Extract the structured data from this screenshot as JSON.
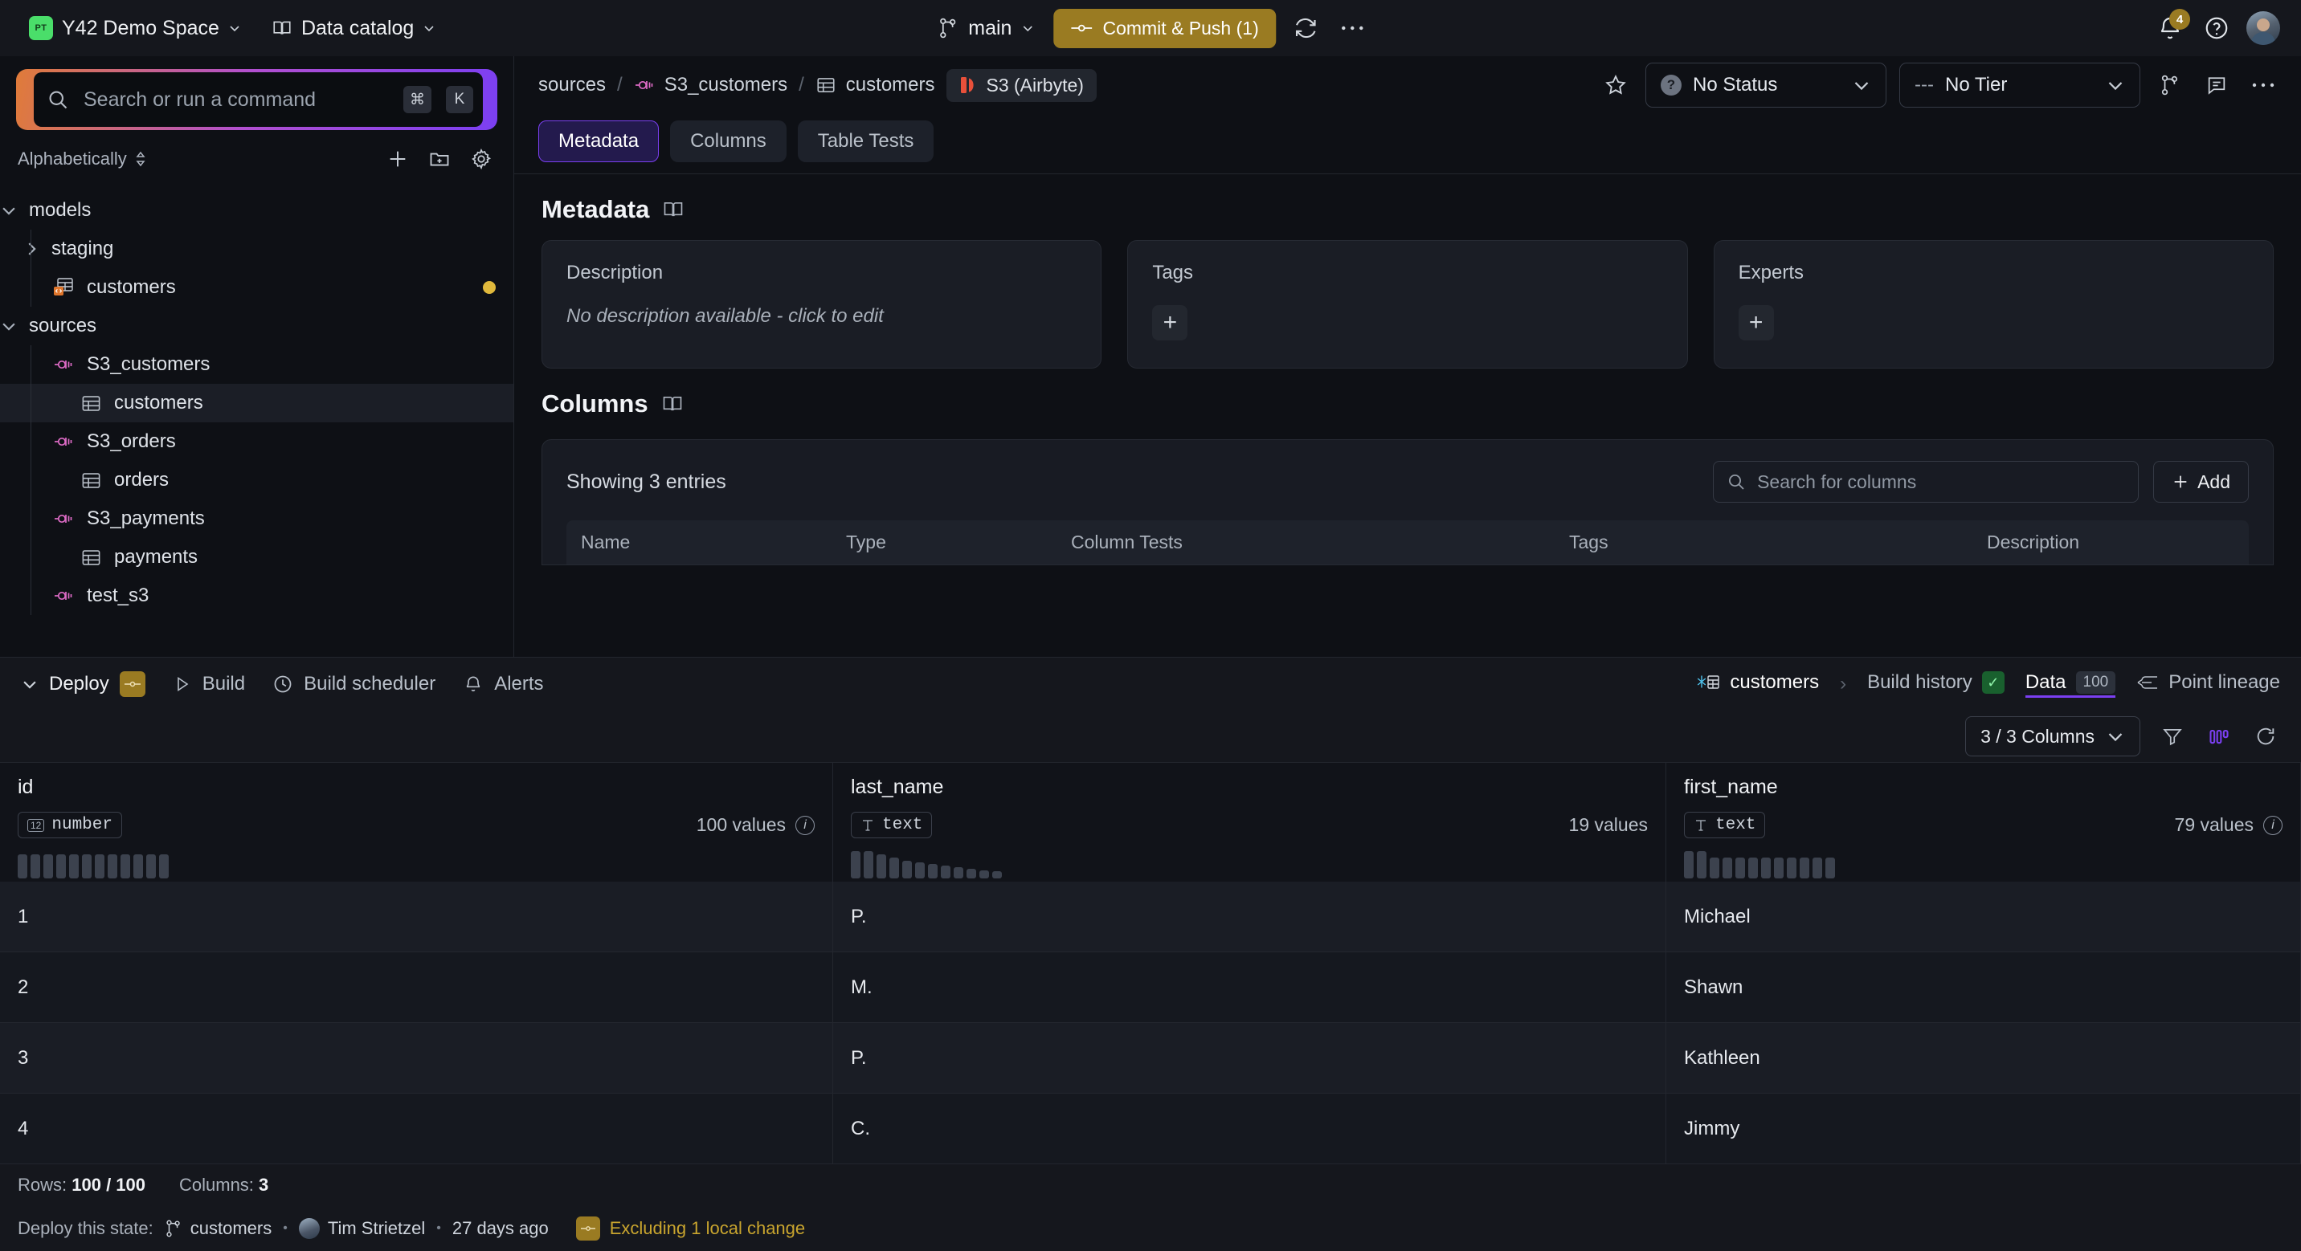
{
  "topbar": {
    "space_badge": "PT",
    "space_name": "Y42 Demo Space",
    "catalog_label": "Data catalog",
    "branch": "main",
    "commit_label": "Commit & Push (1)",
    "notification_count": "4"
  },
  "sidebar": {
    "search_placeholder": "Search or run a command",
    "kbd_cmd": "⌘",
    "kbd_key": "K",
    "sort_label": "Alphabetically",
    "tree": [
      {
        "label": "models",
        "indent": 0,
        "icon": "chevron-down",
        "kind": "folder",
        "selected": false,
        "dot": false
      },
      {
        "label": "staging",
        "indent": 1,
        "icon": "chevron-right",
        "kind": "folder",
        "selected": false,
        "dot": false
      },
      {
        "label": "customers",
        "indent": 1,
        "icon": "none",
        "kind": "model",
        "selected": false,
        "dot": true
      },
      {
        "label": "sources",
        "indent": 0,
        "icon": "chevron-down",
        "kind": "folder",
        "selected": false,
        "dot": false
      },
      {
        "label": "S3_customers",
        "indent": 1,
        "icon": "none",
        "kind": "source",
        "selected": false,
        "dot": false
      },
      {
        "label": "customers",
        "indent": 2,
        "icon": "none",
        "kind": "table",
        "selected": true,
        "dot": false
      },
      {
        "label": "S3_orders",
        "indent": 1,
        "icon": "none",
        "kind": "source",
        "selected": false,
        "dot": false
      },
      {
        "label": "orders",
        "indent": 2,
        "icon": "none",
        "kind": "table",
        "selected": false,
        "dot": false
      },
      {
        "label": "S3_payments",
        "indent": 1,
        "icon": "none",
        "kind": "source",
        "selected": false,
        "dot": false
      },
      {
        "label": "payments",
        "indent": 2,
        "icon": "none",
        "kind": "table",
        "selected": false,
        "dot": false
      },
      {
        "label": "test_s3",
        "indent": 1,
        "icon": "none",
        "kind": "source",
        "selected": false,
        "dot": false
      }
    ]
  },
  "breadcrumb": {
    "root": "sources",
    "source": "S3_customers",
    "table": "customers",
    "connector_chip": "S3 (Airbyte)",
    "status_label": "No Status",
    "tier_label": "No Tier",
    "tier_prefix": "---"
  },
  "tabs": [
    {
      "label": "Metadata",
      "active": true
    },
    {
      "label": "Columns",
      "active": false
    },
    {
      "label": "Table Tests",
      "active": false
    }
  ],
  "metadata": {
    "section_title": "Metadata",
    "description_title": "Description",
    "description_empty": "No description available - click to edit",
    "tags_title": "Tags",
    "experts_title": "Experts",
    "add_glyph": "+"
  },
  "columns_section": {
    "section_title": "Columns",
    "showing": "Showing 3 entries",
    "search_placeholder": "Search for columns",
    "add_label": "Add",
    "headers": [
      "Name",
      "Type",
      "Column Tests",
      "Tags",
      "Description"
    ]
  },
  "bottom_panel": {
    "deploy_label": "Deploy",
    "build_label": "Build",
    "build_scheduler_label": "Build scheduler",
    "alerts_label": "Alerts",
    "asset_name": "customers",
    "build_history_label": "Build history",
    "data_tab_label": "Data",
    "data_tab_count": "100",
    "point_lineage_label": "Point lineage",
    "columns_select_label": "3 / 3 Columns"
  },
  "grid": {
    "columns": [
      {
        "name": "id",
        "type": "number",
        "type_glyph": "12",
        "values_label": "100 values",
        "has_info": true,
        "histogram": [
          30,
          30,
          30,
          30,
          30,
          30,
          30,
          30,
          30,
          30,
          30,
          30
        ]
      },
      {
        "name": "last_name",
        "type": "text",
        "type_glyph": "T",
        "values_label": "19 values",
        "has_info": false,
        "histogram": [
          34,
          34,
          30,
          26,
          22,
          20,
          18,
          16,
          14,
          12,
          10,
          9
        ]
      },
      {
        "name": "first_name",
        "type": "text",
        "type_glyph": "T",
        "values_label": "79 values",
        "has_info": true,
        "histogram": [
          34,
          34,
          26,
          26,
          26,
          26,
          26,
          26,
          26,
          26,
          26,
          26
        ]
      }
    ],
    "rows": [
      {
        "id": "1",
        "last_name": "P.",
        "first_name": "Michael"
      },
      {
        "id": "2",
        "last_name": "M.",
        "first_name": "Shawn"
      },
      {
        "id": "3",
        "last_name": "P.",
        "first_name": "Kathleen"
      },
      {
        "id": "4",
        "last_name": "C.",
        "first_name": "Jimmy"
      }
    ]
  },
  "statusbar": {
    "rows_label": "Rows:",
    "rows_value": "100 / 100",
    "columns_label": "Columns:",
    "columns_value": "3",
    "deploy_state_label": "Deploy this state:",
    "deploy_branch": "customers",
    "deploy_author": "Tim Strietzel",
    "deploy_time": "27 days ago",
    "excluding_label": "Excluding 1 local change",
    "dot": "•"
  },
  "colors": {
    "accent_purple": "#7b3ff2",
    "commit_gold": "#9a7b22",
    "source_pink": "#e06cc8",
    "model_orange": "#e0762c",
    "green_badge": "#4ade6a",
    "warn_amber": "#e0b93c"
  }
}
